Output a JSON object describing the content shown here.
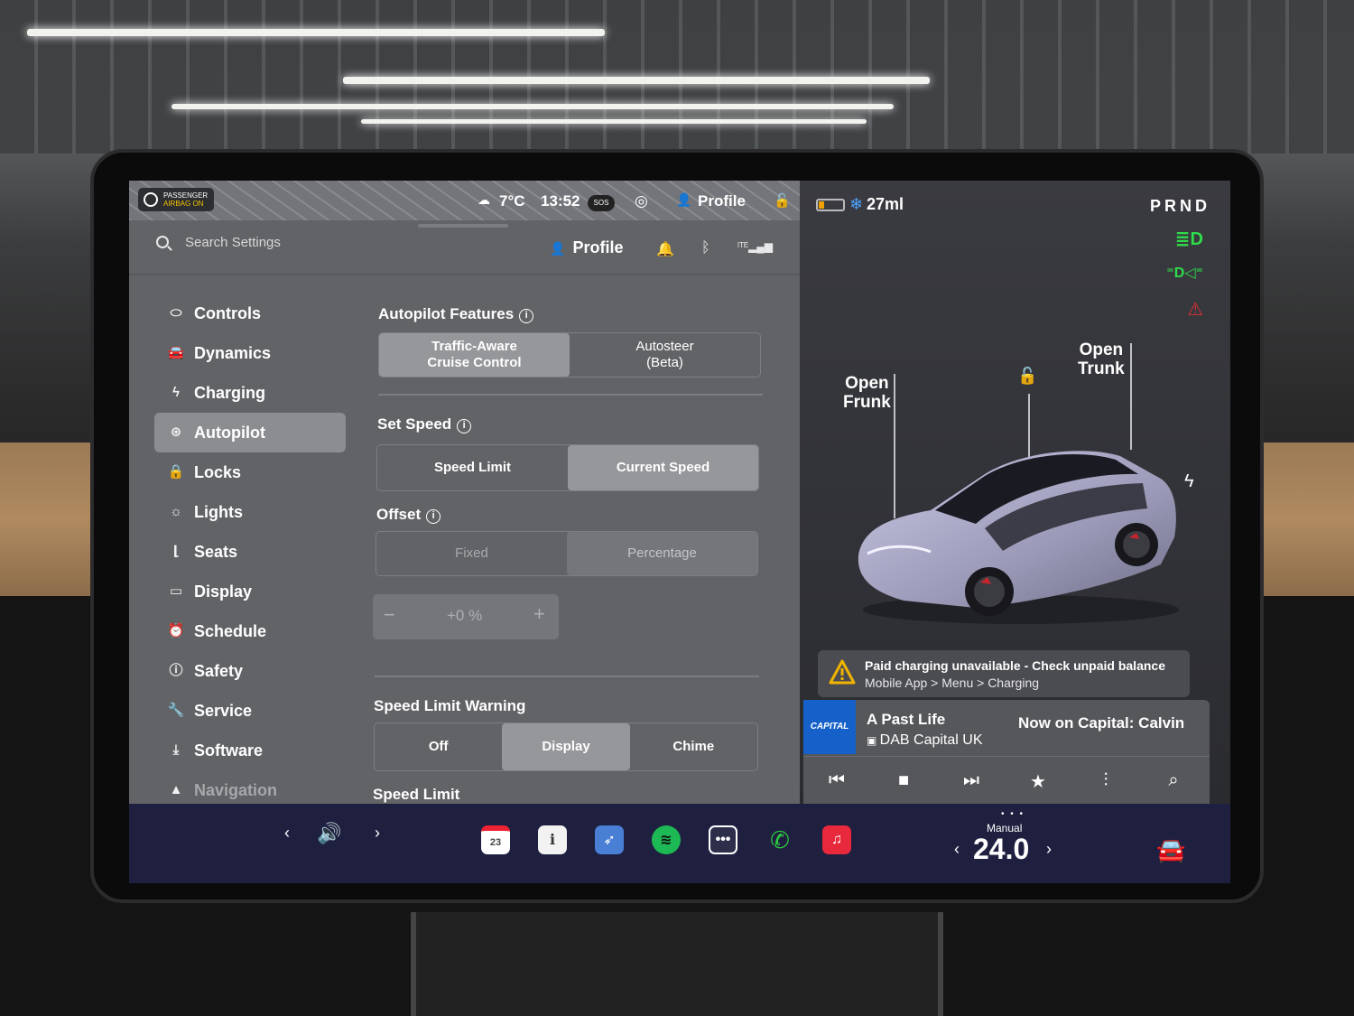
{
  "status_bar": {
    "airbag_label": "PASSENGER",
    "airbag_status": "AIRBAG ON",
    "temperature": "7°C",
    "time": "13:52",
    "sos_label": "SOS",
    "profile_label": "Profile"
  },
  "settings_header": {
    "search_placeholder": "Search Settings",
    "profile_label": "Profile"
  },
  "sidebar": {
    "items": [
      {
        "label": "Controls",
        "icon": "toggle-icon"
      },
      {
        "label": "Dynamics",
        "icon": "car-icon"
      },
      {
        "label": "Charging",
        "icon": "bolt-icon"
      },
      {
        "label": "Autopilot",
        "icon": "steering-wheel-icon",
        "active": true
      },
      {
        "label": "Locks",
        "icon": "lock-icon"
      },
      {
        "label": "Lights",
        "icon": "sun-icon"
      },
      {
        "label": "Seats",
        "icon": "seat-icon"
      },
      {
        "label": "Display",
        "icon": "display-icon"
      },
      {
        "label": "Schedule",
        "icon": "alarm-icon"
      },
      {
        "label": "Safety",
        "icon": "alert-circle-icon"
      },
      {
        "label": "Service",
        "icon": "wrench-icon"
      },
      {
        "label": "Software",
        "icon": "download-icon"
      },
      {
        "label": "Navigation",
        "icon": "navigation-icon"
      }
    ]
  },
  "autopilot": {
    "features_title": "Autopilot Features",
    "features_options": [
      "Traffic-Aware\nCruise Control",
      "Autosteer\n(Beta)"
    ],
    "features_selected": "Traffic-Aware Cruise Control",
    "set_speed_title": "Set Speed",
    "set_speed_options": [
      "Speed Limit",
      "Current Speed"
    ],
    "set_speed_selected": "Current Speed",
    "offset_title": "Offset",
    "offset_options": [
      "Fixed",
      "Percentage"
    ],
    "offset_selected": "Percentage",
    "offset_value": "+0 %",
    "speed_limit_warning_title": "Speed Limit Warning",
    "speed_limit_warning_options": [
      "Off",
      "Display",
      "Chime"
    ],
    "speed_limit_warning_selected": "Display",
    "speed_limit_title": "Speed Limit"
  },
  "vehicle": {
    "range": "27ml",
    "gear_selector": "PRND",
    "open_frunk": "Open\nFrunk",
    "open_trunk": "Open\nTrunk",
    "alert_title": "Paid charging unavailable - Check unpaid balance",
    "alert_subtitle": "Mobile App > Menu > Charging"
  },
  "media": {
    "station_logo": "CAPITAL",
    "song": "A Past Life",
    "station": "DAB Capital UK",
    "now_playing": "Now on Capital: Calvin"
  },
  "taskbar": {
    "calendar_day": "23",
    "climate_mode": "Manual",
    "temperature_setting": "24.0"
  },
  "colors": {
    "settings_bg": "#626366",
    "selected_segment": "#96979b",
    "taskbar_bg": "#1f2040",
    "spotify": "#1db954",
    "phone": "#2ecc40",
    "music": "#e8283b",
    "headlight_indicator": "#2fdc4a",
    "seatbelt_warning": "#e0302f"
  }
}
